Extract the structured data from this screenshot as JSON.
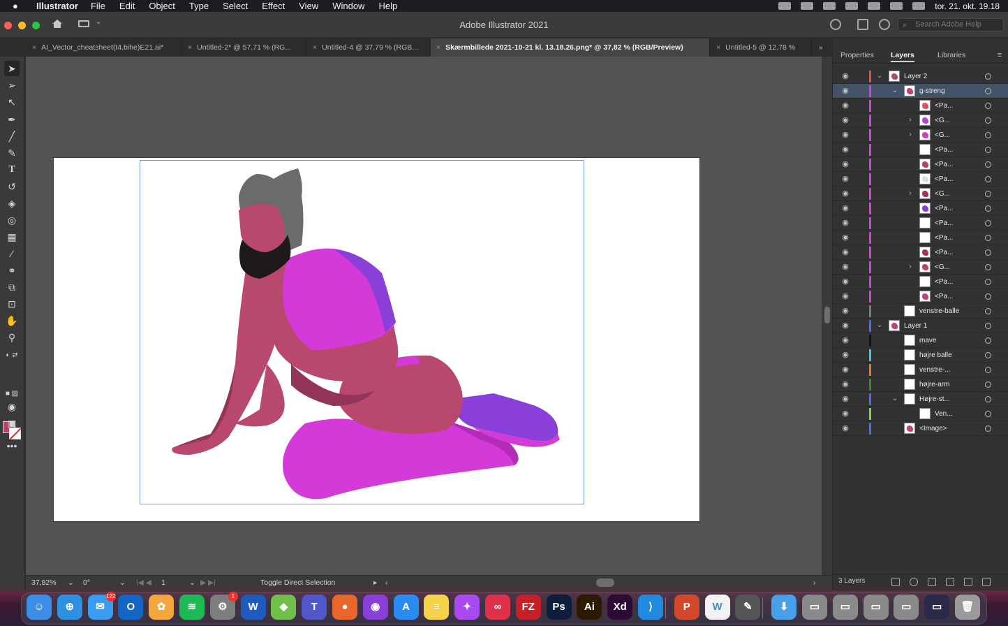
{
  "menubar": {
    "app_name": "Illustrator",
    "items": [
      "File",
      "Edit",
      "Object",
      "Type",
      "Select",
      "Effect",
      "View",
      "Window",
      "Help"
    ],
    "clock": "tor. 21. okt.  19.18"
  },
  "window": {
    "title": "Adobe Illustrator 2021",
    "search_placeholder": "Search Adobe Help"
  },
  "tabs": [
    {
      "label": "AI_Vector_cheatsheet(t4,bihe)E21.ai*",
      "active": false
    },
    {
      "label": "Untitled-2* @ 57,71 % (RG...",
      "active": false
    },
    {
      "label": "Untitled-4 @ 37,79 % (RGB...",
      "active": false
    },
    {
      "label": "Skærmbillede 2021-10-21 kl. 13.18.26.png* @ 37,82 % (RGB/Preview)",
      "active": true
    },
    {
      "label": "Untitled-5 @ 12,78 %",
      "active": false
    }
  ],
  "panel": {
    "tabs": [
      "Properties",
      "Layers",
      "Libraries"
    ],
    "active_tab": "Layers",
    "footer_count": "3 Layers"
  },
  "layers": [
    {
      "name": "Layer 2",
      "chev": "down",
      "level": 0,
      "color": "#e0504a",
      "thumb": "#c0407a"
    },
    {
      "name": "g-streng",
      "chev": "down",
      "level": 1,
      "color": "#d044d6",
      "thumb": "#c0407a",
      "selected": true
    },
    {
      "name": "<Pa...",
      "chev": "",
      "level": 2,
      "color": "#d044d6",
      "thumb": "#e0505a"
    },
    {
      "name": "<G...",
      "chev": "right",
      "level": 2,
      "color": "#d044d6",
      "thumb": "#b840d8"
    },
    {
      "name": "<G...",
      "chev": "right",
      "level": 2,
      "color": "#d044d6",
      "thumb": "#d640b0"
    },
    {
      "name": "<Pa...",
      "chev": "",
      "level": 2,
      "color": "#d044d6",
      "thumb": "#ffffff"
    },
    {
      "name": "<Pa...",
      "chev": "",
      "level": 2,
      "color": "#d044d6",
      "thumb": "#b83f6e"
    },
    {
      "name": "<Pa...",
      "chev": "",
      "level": 2,
      "color": "#d044d6",
      "thumb": "#dddddd"
    },
    {
      "name": "<G...",
      "chev": "right",
      "level": 2,
      "color": "#d044d6",
      "thumb": "#a8305a"
    },
    {
      "name": "<Pa...",
      "chev": "",
      "level": 2,
      "color": "#d044d6",
      "thumb": "#8a40d8"
    },
    {
      "name": "<Pa...",
      "chev": "",
      "level": 2,
      "color": "#d044d6",
      "thumb": "#ffffff"
    },
    {
      "name": "<Pa...",
      "chev": "",
      "level": 2,
      "color": "#d044d6",
      "thumb": "#ffffff"
    },
    {
      "name": "<Pa...",
      "chev": "",
      "level": 2,
      "color": "#d044d6",
      "thumb": "#a8305a"
    },
    {
      "name": "<G...",
      "chev": "right",
      "level": 2,
      "color": "#d044d6",
      "thumb": "#c0407a"
    },
    {
      "name": "<Pa...",
      "chev": "",
      "level": 2,
      "color": "#d044d6",
      "thumb": "#ffffff"
    },
    {
      "name": "<Pa...",
      "chev": "",
      "level": 2,
      "color": "#d044d6",
      "thumb": "#c0407a"
    },
    {
      "name": "venstre-balle",
      "chev": "",
      "level": 1,
      "color": "#7a7a7a",
      "thumb": "#ffffff"
    },
    {
      "name": "Layer 1",
      "chev": "down",
      "level": 0,
      "color": "#4a6cf0",
      "thumb": "#c0407a"
    },
    {
      "name": "mave",
      "chev": "",
      "level": 1,
      "color": "#111111",
      "thumb": "#ffffff"
    },
    {
      "name": "højre balle",
      "chev": "",
      "level": 1,
      "color": "#40c8d8",
      "thumb": "#ffffff"
    },
    {
      "name": "venstre-...",
      "chev": "",
      "level": 1,
      "color": "#e87a2a",
      "thumb": "#ffffff"
    },
    {
      "name": "højre-arm",
      "chev": "",
      "level": 1,
      "color": "#3a8a2a",
      "thumb": "#ffffff"
    },
    {
      "name": "Højre-st...",
      "chev": "down",
      "level": 1,
      "color": "#4a6cf0",
      "thumb": "#ffffff"
    },
    {
      "name": "Ven...",
      "chev": "",
      "level": 2,
      "color": "#7ad84a",
      "thumb": "#ffffff"
    },
    {
      "name": "<Image>",
      "chev": "",
      "level": 1,
      "color": "#4a6cf0",
      "thumb": "#c0407a"
    }
  ],
  "status": {
    "zoom": "37,82%",
    "rotation": "0°",
    "artboard_num": "1",
    "tool_hint": "Toggle Direct Selection"
  },
  "dock": {
    "apps": [
      {
        "name": "Finder",
        "label": "☺",
        "bg": "#3c8de8"
      },
      {
        "name": "Safari",
        "label": "⊕",
        "bg": "#2f8fe0"
      },
      {
        "name": "Mail",
        "label": "✉",
        "bg": "#3a9cf0",
        "badge": "122"
      },
      {
        "name": "Outlook",
        "label": "O",
        "bg": "#1366c4"
      },
      {
        "name": "Photos",
        "label": "✿",
        "bg": "#f3a63a"
      },
      {
        "name": "Spotify",
        "label": "≋",
        "bg": "#1db954"
      },
      {
        "name": "System Preferences",
        "label": "⚙",
        "bg": "#7d7d7d",
        "badge": "1"
      },
      {
        "name": "Word",
        "label": "W",
        "bg": "#1f5bbf"
      },
      {
        "name": "Sims",
        "label": "◆",
        "bg": "#6fbf4a"
      },
      {
        "name": "Teams",
        "label": "T",
        "bg": "#5058c8"
      },
      {
        "name": "Firefox",
        "label": "●",
        "bg": "#e8662a"
      },
      {
        "name": "Podcasts",
        "label": "◉",
        "bg": "#8a3fd8"
      },
      {
        "name": "App Store",
        "label": "A",
        "bg": "#2a8cf0"
      },
      {
        "name": "Notes",
        "label": "≡",
        "bg": "#f6d24a"
      },
      {
        "name": "Messenger",
        "label": "✦",
        "bg": "#a84af0"
      },
      {
        "name": "Creative Cloud",
        "label": "∞",
        "bg": "#e0304a"
      },
      {
        "name": "FileZilla",
        "label": "FZ",
        "bg": "#c8202a"
      },
      {
        "name": "Photoshop",
        "label": "Ps",
        "bg": "#0f1e3c"
      },
      {
        "name": "Illustrator",
        "label": "Ai",
        "bg": "#2e1a00"
      },
      {
        "name": "XD",
        "label": "Xd",
        "bg": "#2e0a36"
      },
      {
        "name": "VS Code",
        "label": "⟩",
        "bg": "#1f8ae0"
      },
      {
        "name": "PowerPoint",
        "label": "P",
        "bg": "#d2482a"
      },
      {
        "name": "Wunderlist",
        "label": "W",
        "bg": "#f2f2f2"
      },
      {
        "name": "Script Editor",
        "label": "✎",
        "bg": "#555555"
      },
      {
        "name": "Downloads",
        "label": "⬇",
        "bg": "#4aa0e8"
      },
      {
        "name": "Window 1",
        "label": "▭",
        "bg": "#8a8a8a"
      },
      {
        "name": "Window 2",
        "label": "▭",
        "bg": "#8a8a8a"
      },
      {
        "name": "Window 3",
        "label": "▭",
        "bg": "#8a8a8a"
      },
      {
        "name": "Window 4",
        "label": "▭",
        "bg": "#8a8a8a"
      },
      {
        "name": "Window 5",
        "label": "▭",
        "bg": "#2a2a4a"
      },
      {
        "name": "Trash",
        "label": "🗑",
        "bg": "#9a9a9a"
      }
    ]
  },
  "colors": {
    "fill": "#b83f6e",
    "skin": "#b9486e",
    "skin_dark": "#93345a",
    "suit": "#d43ad8",
    "suit_shadow": "#8a3fd8",
    "hat": "#6b6b6b",
    "beard": "#1e1a1c"
  }
}
